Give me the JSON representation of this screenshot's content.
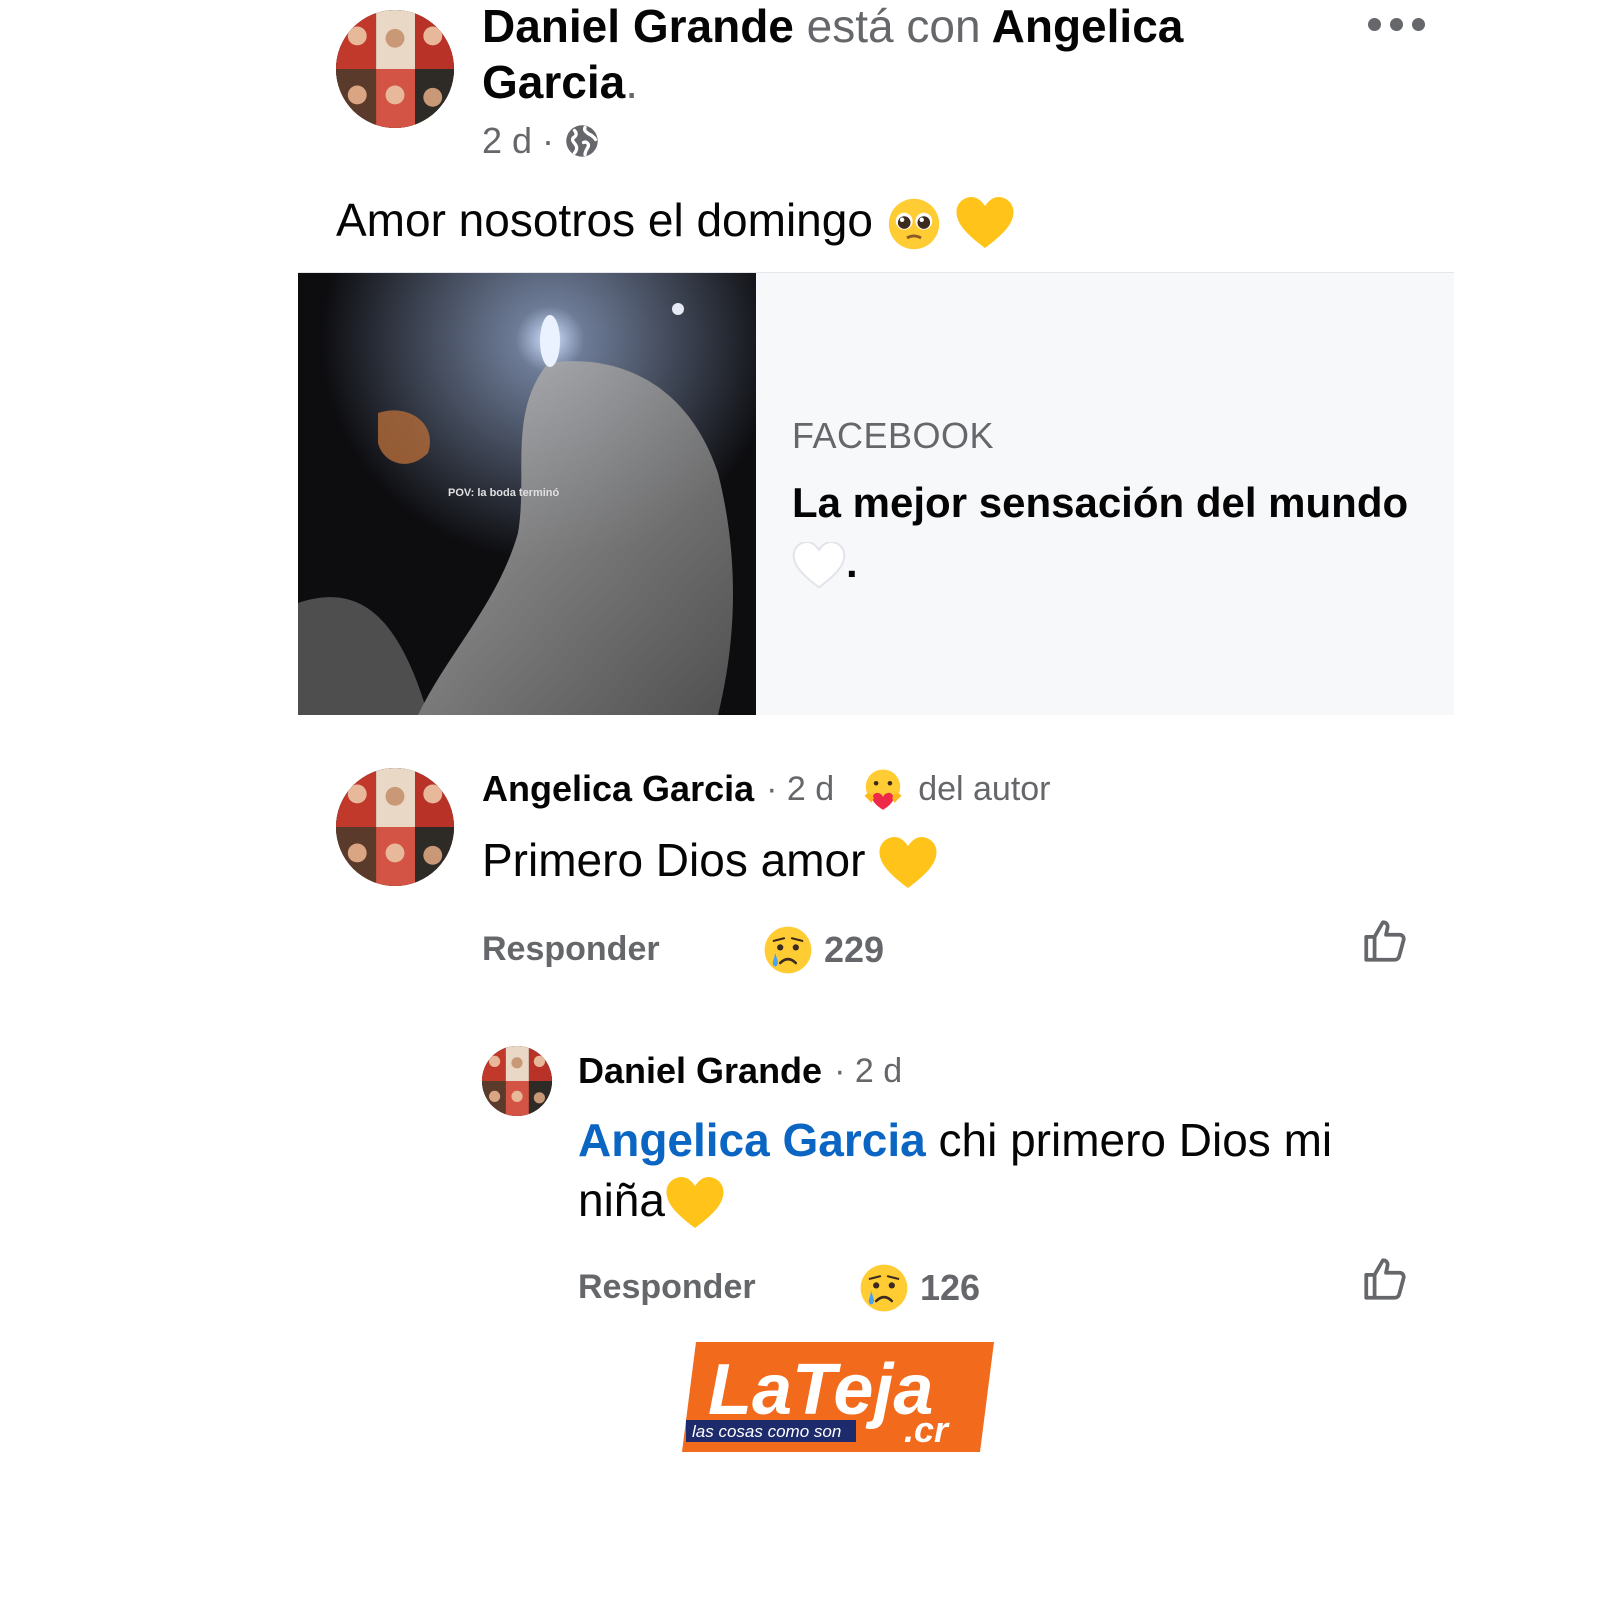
{
  "post": {
    "author": "Daniel Grande",
    "with_text": "está con",
    "tagged_first": "Angelica",
    "tagged_second": "Garcia",
    "period": ".",
    "time": "2 d",
    "separator": "·",
    "text": "Amor nosotros el domingo"
  },
  "link_card": {
    "source": "FACEBOOK",
    "title": "La mejor sensación del mundo",
    "title_end": ".",
    "thumb_caption": "POV: la boda terminó"
  },
  "comment": {
    "author": "Angelica Garcia",
    "time": "· 2 d",
    "badge": "del autor",
    "text": "Primero Dios amor",
    "reply": "Responder",
    "reaction_count": "229"
  },
  "reply": {
    "author": "Daniel Grande",
    "time": "· 2 d",
    "mention": "Angelica Garcia",
    "text_line1": "chi primero Dios mi",
    "text_line2": "niña",
    "reply": "Responder",
    "reaction_count": "126"
  },
  "logo": {
    "text": "LaTeja",
    "tld": ".cr",
    "tagline": "las cosas como son"
  },
  "colors": {
    "text": "#050505",
    "secondary": "#65676b",
    "mention": "#0a66c2",
    "logo_orange": "#f26a1b",
    "logo_navy": "#1d2a6b"
  },
  "icons": [
    "more-options-icon",
    "globe-icon",
    "pleading-face-emoji",
    "yellow-heart-emoji",
    "white-heart-emoji",
    "care-reaction-icon",
    "sad-reaction-icon",
    "like-icon"
  ]
}
